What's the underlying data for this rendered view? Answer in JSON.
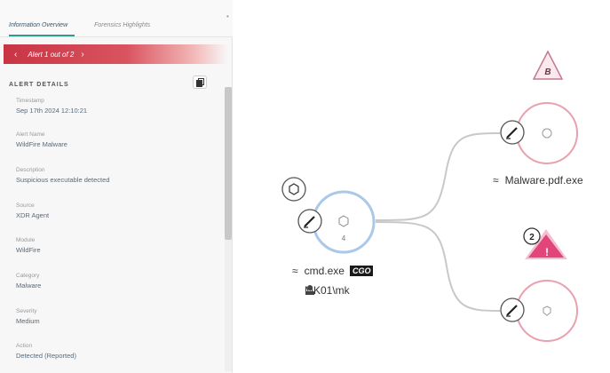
{
  "tabs": [
    {
      "label": "Information Overview",
      "active": true
    },
    {
      "label": "Forensics Highlights",
      "active": false
    }
  ],
  "alert_nav": {
    "prev": "‹",
    "count_text": "Alert 1 out of 2",
    "next": "›"
  },
  "section_title": "ALERT DETAILS",
  "details": [
    {
      "label": "Timestamp",
      "value": "Sep 17th 2024 12:10:21"
    },
    {
      "label": "Alert Name",
      "value": "WildFire Malware"
    },
    {
      "label": "Description",
      "value": "Suspicious executable detected"
    },
    {
      "label": "Source",
      "value": "XDR Agent"
    },
    {
      "label": "Module",
      "value": "WildFire"
    },
    {
      "label": "Category",
      "value": "Malware"
    },
    {
      "label": "Severity",
      "value": "Medium"
    },
    {
      "label": "Action",
      "value": "Detected (Reported)"
    }
  ],
  "graph": {
    "main_node": {
      "process": "cmd.exe",
      "badge": "CGO",
      "user": "MK01\\mk",
      "count": "4"
    },
    "child_top": {
      "process": "Malware.pdf.exe",
      "alert_letter": "B"
    },
    "child_bottom": {
      "alert_count": "2",
      "alert_mark": "!"
    }
  },
  "colors": {
    "accent_teal": "#2a9d8f",
    "alert_red": "#c93445",
    "node_ring_pink": "#e8a0ae",
    "node_ring_blue": "#a9c8ea",
    "warning_pink": "#e2457a"
  },
  "icons": [
    "copy-icon",
    "terminal-icon",
    "hexagon-icon",
    "link-icon",
    "user-icon",
    "warning-icon"
  ]
}
